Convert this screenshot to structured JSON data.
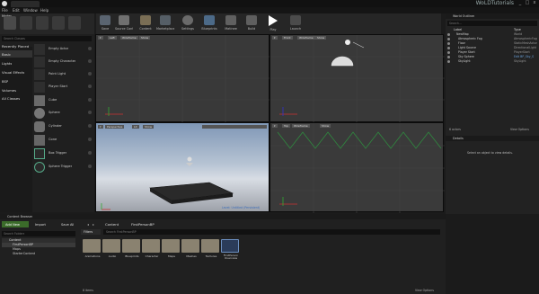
{
  "app": {
    "brand": "WoLDTutorials",
    "colors": {
      "accent": "#2e74b5",
      "folder": "#8a8270",
      "play": "#ffffff"
    }
  },
  "menu": [
    "File",
    "Edit",
    "Window",
    "Help"
  ],
  "window_buttons": [
    "_",
    "□",
    "x"
  ],
  "modes": {
    "label": "Modes",
    "search_placeholder": "Search Classes"
  },
  "place_categories": [
    "Recently Placed",
    "Basic",
    "Lights",
    "Visual Effects",
    "BSP",
    "Volumes",
    "All Classes"
  ],
  "place_items": [
    "Empty Actor",
    "Empty Character",
    "Point Light",
    "Player Start",
    "Cube",
    "Sphere",
    "Cylinder",
    "Cone",
    "Box Trigger",
    "Sphere Trigger"
  ],
  "toolbar": [
    "Save",
    "Source Control",
    "Content",
    "Marketplace",
    "Settings",
    "Blueprints",
    "Matinee",
    "Build",
    "Play",
    "Launch"
  ],
  "viewports": {
    "top_left": {
      "btns": [
        "Left",
        "Wireframe",
        "Show"
      ],
      "lock": "LL"
    },
    "top_right": {
      "btns": [
        "Front",
        "Wireframe",
        "Show"
      ]
    },
    "bottom_left": {
      "btns": [
        "Perspective",
        "Lit",
        "Show"
      ],
      "corner": "Level: Untitled (Persistent)"
    },
    "bottom_right": {
      "btns": [
        "Top",
        "Wireframe",
        "Show"
      ]
    }
  },
  "outliner": {
    "title": "World Outliner",
    "search_placeholder": "Search...",
    "columns": [
      "Label",
      "Type"
    ],
    "rows": [
      {
        "label": "NewMap",
        "type": "World"
      },
      {
        "label": "Atmospheric Fog",
        "type": "AtmosphericFog"
      },
      {
        "label": "Floor",
        "type": "StaticMeshActor"
      },
      {
        "label": "Light Source",
        "type": "DirectionalLight"
      },
      {
        "label": "Player Start",
        "type": "PlayerStart"
      },
      {
        "label": "Sky Sphere",
        "type": "Edit BP_Sky_S"
      },
      {
        "label": "SkyLight",
        "type": "SkyLight"
      }
    ],
    "count": "6 actors",
    "view_options": "View Options"
  },
  "details": {
    "title": "Details",
    "empty": "Select an object to view details."
  },
  "content_browser": {
    "title": "Content Browser",
    "add_new": "Add New",
    "import": "Import",
    "save_all": "Save All",
    "path": [
      "Content",
      "FirstPersonBP"
    ],
    "search_placeholder": "Search Folders",
    "filters": "Filters",
    "search_assets": "Search FirstPersonBP",
    "tree": [
      "Content",
      "FirstPersonBP",
      "Maps",
      "StarterContent"
    ],
    "folders": [
      "Animations",
      "Audio",
      "Blueprints",
      "Character",
      "Maps",
      "Meshes",
      "Textures",
      "FirstPerson Overview"
    ],
    "count": "8 items",
    "view_options": "View Options"
  }
}
